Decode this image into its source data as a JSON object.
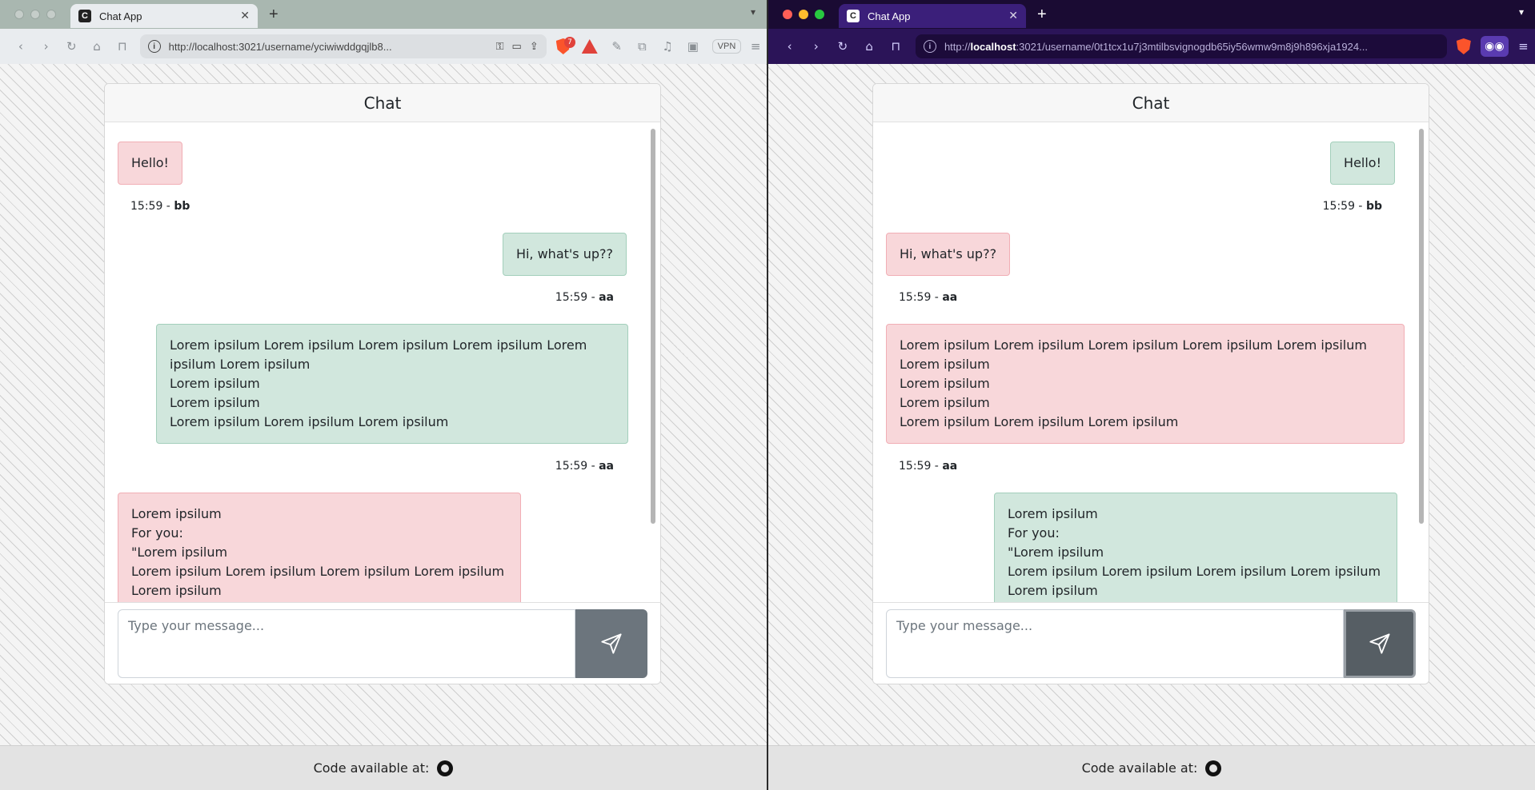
{
  "windows": [
    {
      "tab_title": "Chat App",
      "favicon_letter": "C",
      "url": "http://localhost:3021/username/yciwiwddgqjlb8...",
      "vpn_label": "VPN",
      "rewards_count": "7",
      "chat": {
        "title": "Chat",
        "messages": [
          {
            "text": "Hello!",
            "time": "15:59 -",
            "user": "bb",
            "side": "left",
            "color": "pink"
          },
          {
            "text": "Hi, what's up??",
            "time": "15:59 -",
            "user": "aa",
            "side": "right",
            "color": "green"
          },
          {
            "text": "Lorem ipsilum Lorem ipsilum Lorem ipsilum Lorem ipsilum Lorem\nipsilum Lorem ipsilum\nLorem ipsilum\nLorem ipsilum\nLorem ipsilum Lorem ipsilum Lorem ipsilum",
            "time": "15:59 -",
            "user": "aa",
            "side": "right",
            "color": "green"
          },
          {
            "text": "Lorem ipsilum\nFor you:\n\"Lorem ipsilum\nLorem ipsilum Lorem ipsilum Lorem ipsilum Lorem ipsilum\nLorem ipsilum",
            "side": "left",
            "color": "pink"
          }
        ],
        "input_placeholder": "Type your message..."
      },
      "footer_text": "Code available at:"
    },
    {
      "tab_title": "Chat App",
      "favicon_letter": "C",
      "url_prefix": "http://",
      "url_host": "localhost",
      "url_rest": ":3021/username/0t1tcx1u7j3mtilbsvignogdb65iy56wmw9m8j9h896xja1924...",
      "chat": {
        "title": "Chat",
        "messages": [
          {
            "text": "Hello!",
            "time": "15:59 -",
            "user": "bb",
            "side": "right",
            "color": "green"
          },
          {
            "text": "Hi, what's up??",
            "time": "15:59 -",
            "user": "aa",
            "side": "left",
            "color": "pink"
          },
          {
            "text": "Lorem ipsilum Lorem ipsilum Lorem ipsilum Lorem ipsilum Lorem ipsilum\nLorem ipsilum\nLorem ipsilum\nLorem ipsilum\nLorem ipsilum Lorem ipsilum Lorem ipsilum",
            "time": "15:59 -",
            "user": "aa",
            "side": "left",
            "color": "pink"
          },
          {
            "text": "Lorem ipsilum\nFor you:\n\"Lorem ipsilum\nLorem ipsilum Lorem ipsilum Lorem ipsilum Lorem ipsilum\nLorem ipsilum",
            "side": "right",
            "color": "green"
          }
        ],
        "input_placeholder": "Type your message..."
      },
      "footer_text": "Code available at:"
    }
  ],
  "colors": {
    "pink_bubble": "#f8d7da",
    "green_bubble": "#d1e7dd",
    "send_button": "#6c757d",
    "right_browser_chrome": "#2b1458"
  },
  "icons": [
    "back-icon",
    "forward-icon",
    "reload-icon",
    "home-icon",
    "bookmark-icon",
    "info-icon",
    "key-icon",
    "share-icon",
    "brave-shield-icon",
    "rewards-icon",
    "send-icon",
    "github-icon"
  ]
}
